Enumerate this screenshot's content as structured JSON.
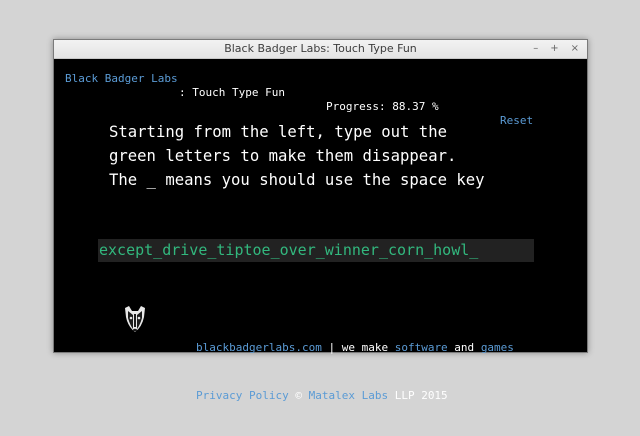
{
  "window": {
    "title": "Black Badger Labs: Touch Type Fun",
    "controls": {
      "minimize": "–",
      "maximize": "+",
      "close": "×"
    }
  },
  "topbar": {
    "brand": "Black Badger Labs",
    "app_name": ": Touch Type Fun",
    "progress_label": "Progress: 88.37 %",
    "reset": "Reset"
  },
  "instructions": [
    "Starting from the left, type out the",
    "green letters to make them disappear.",
    "The _ means you should use the space key"
  ],
  "typing": {
    "remaining_text": "except_drive_tiptoe_over_winner_corn_howl_",
    "progress_percent": 88.37
  },
  "footer": {
    "site_link": "blackbadgerlabs.com",
    "tagline_sep": " | we make ",
    "software_link": "software",
    "and_text": " and ",
    "games_link": "games",
    "privacy_link": "Privacy Policy",
    "copyright_sym": " © ",
    "company_link": "Matalex Labs",
    "company_suffix": " LLP 2015"
  },
  "colors": {
    "accent_link": "#5b9bd5",
    "target_text": "#32b87e",
    "background": "#000000"
  },
  "icons": [
    "badger-logo-icon"
  ]
}
